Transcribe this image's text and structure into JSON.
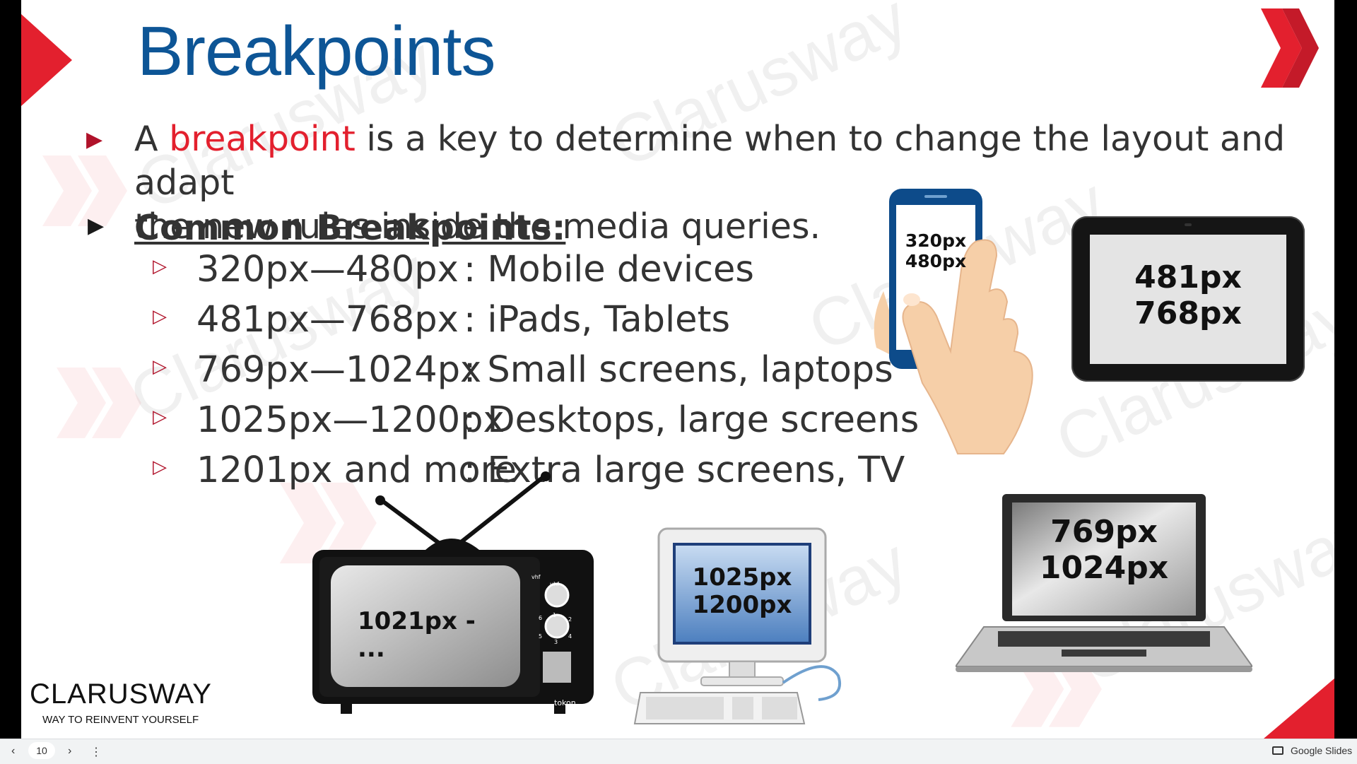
{
  "slide": {
    "title": "Breakpoints",
    "bullet1": {
      "prefix": "A ",
      "highlight": "breakpoint",
      "line1_rest": " is a key to determine when to change the layout and adapt",
      "line2": "the new rules inside the media queries."
    },
    "common_heading": "Common Breakpoints:",
    "breakpoints": [
      {
        "range": "320px—480px",
        "desc": ": Mobile devices"
      },
      {
        "range": "481px—768px",
        "desc": ": iPads, Tablets"
      },
      {
        "range": "769px—1024px",
        "desc": ": Small screens, laptops"
      },
      {
        "range": "1025px—1200px",
        "desc": ": Desktops, large screens"
      },
      {
        "range": "1201px and more",
        "desc": ": Extra large screens, TV"
      }
    ],
    "devices": {
      "phone": [
        "320px",
        "480px"
      ],
      "tablet": [
        "481px",
        "768px"
      ],
      "laptop": [
        "769px",
        "1024px"
      ],
      "desktop": [
        "1025px",
        "1200px"
      ],
      "tv": [
        "1021px -",
        "..."
      ],
      "tv_knob_labels": [
        "vhf",
        "uhf",
        "1",
        "2",
        "3",
        "4",
        "5",
        "6"
      ],
      "tv_brand": "tokon"
    },
    "watermark": "Clarusway",
    "brand": {
      "name": "CLARUSWAY",
      "tagline": "WAY TO REINVENT YOURSELF"
    },
    "colors": {
      "title": "#0d5596",
      "accent": "#e3202e",
      "bullet": "#b0122a"
    }
  },
  "bottom_bar": {
    "page_number": "10",
    "app_name": "Google Slides",
    "icons": [
      "chevron-left-icon",
      "chevron-right-icon",
      "more-vert-icon",
      "slides-icon"
    ]
  }
}
